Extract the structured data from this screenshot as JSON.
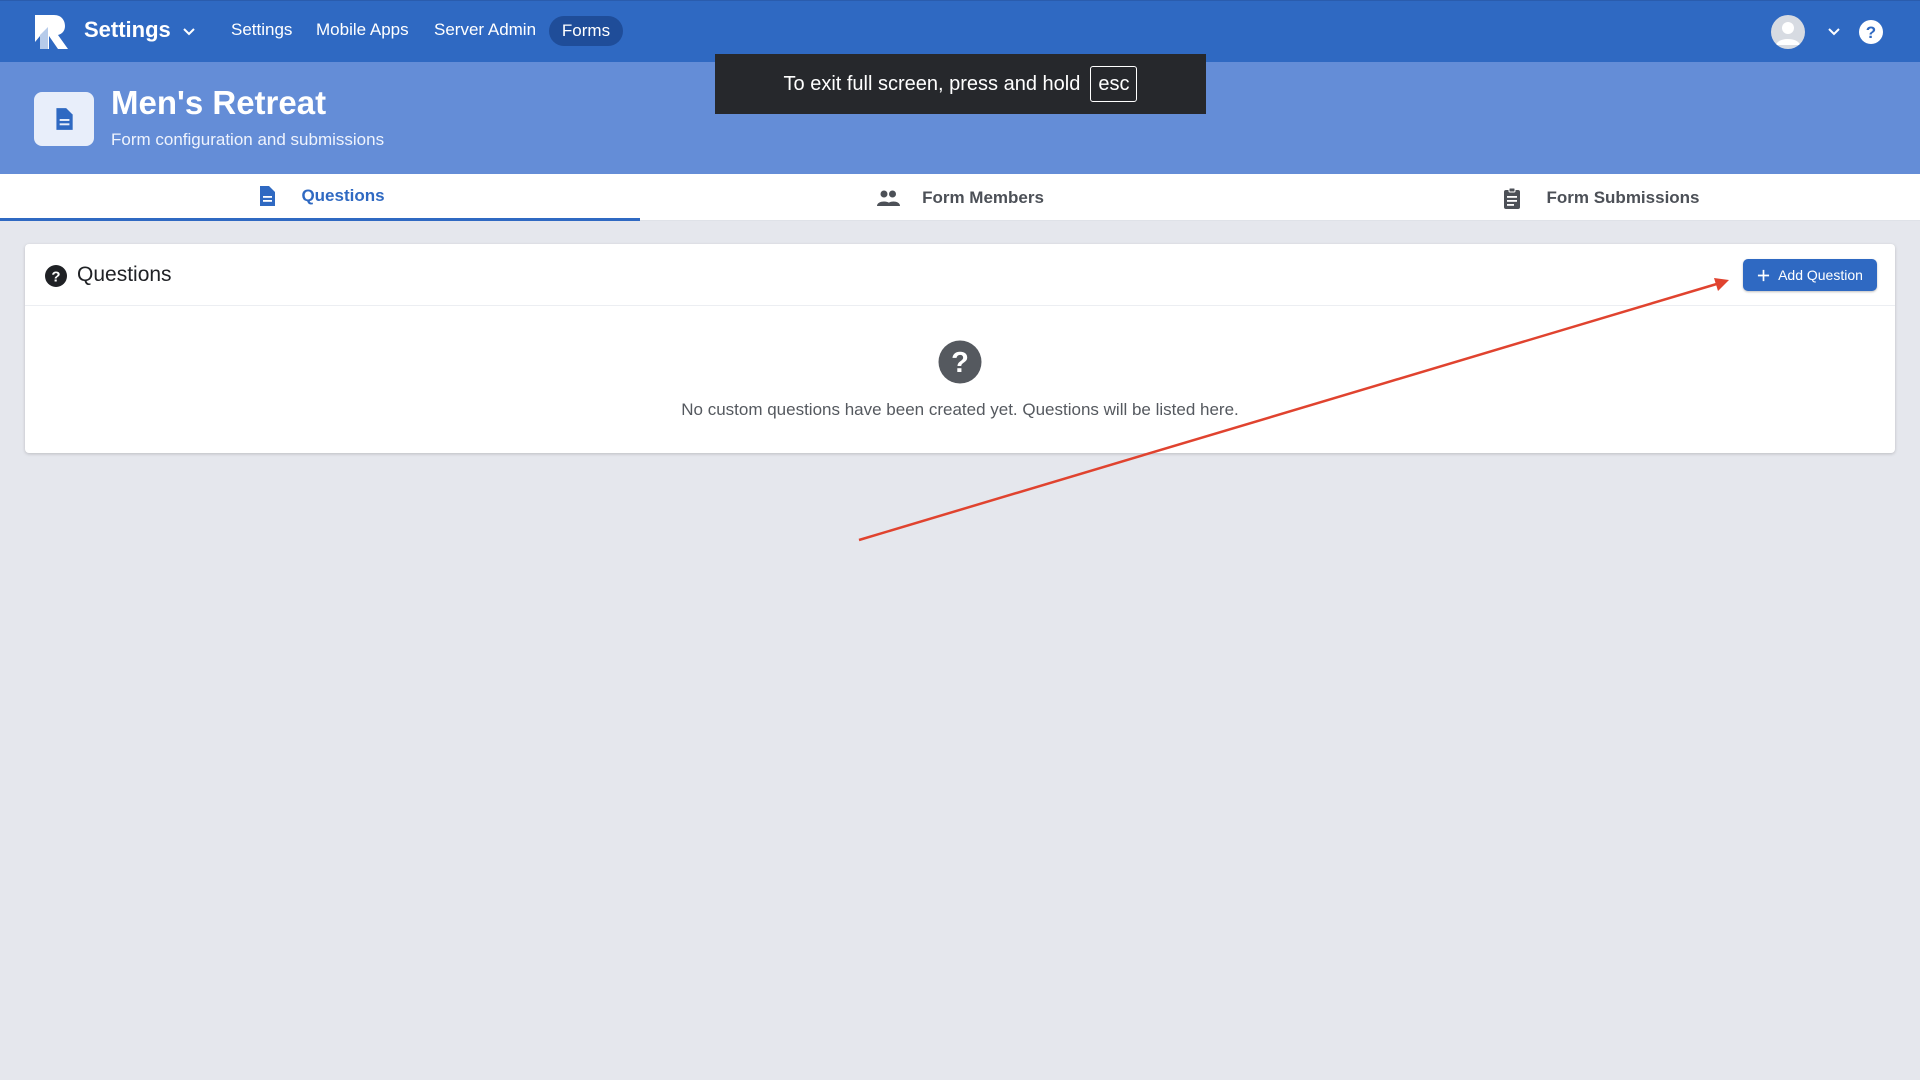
{
  "app": {
    "title": "Settings",
    "logo_icon": "rock-logo-icon"
  },
  "nav": {
    "items": [
      "Settings",
      "Mobile Apps",
      "Server Admin"
    ],
    "active": "Forms"
  },
  "header": {
    "title": "Men's Retreat",
    "subtitle": "Form configuration and submissions",
    "icon": "file-document-icon"
  },
  "toast": {
    "text": "To exit full screen, press and hold",
    "key": "esc"
  },
  "tabs": [
    {
      "label": "Questions",
      "icon": "file-document-icon",
      "active": true
    },
    {
      "label": "Form Members",
      "icon": "users-icon",
      "active": false
    },
    {
      "label": "Form Submissions",
      "icon": "clipboard-icon",
      "active": false
    }
  ],
  "card": {
    "title": "Questions",
    "add_button": "Add Question",
    "empty_message": "No custom questions have been created yet. Questions will be listed here."
  },
  "colors": {
    "topbar": "#2f69c2",
    "header": "#648dd7",
    "accent": "#2f69c2",
    "annotation_arrow": "#e0432f",
    "background": "#e5e7ed"
  }
}
